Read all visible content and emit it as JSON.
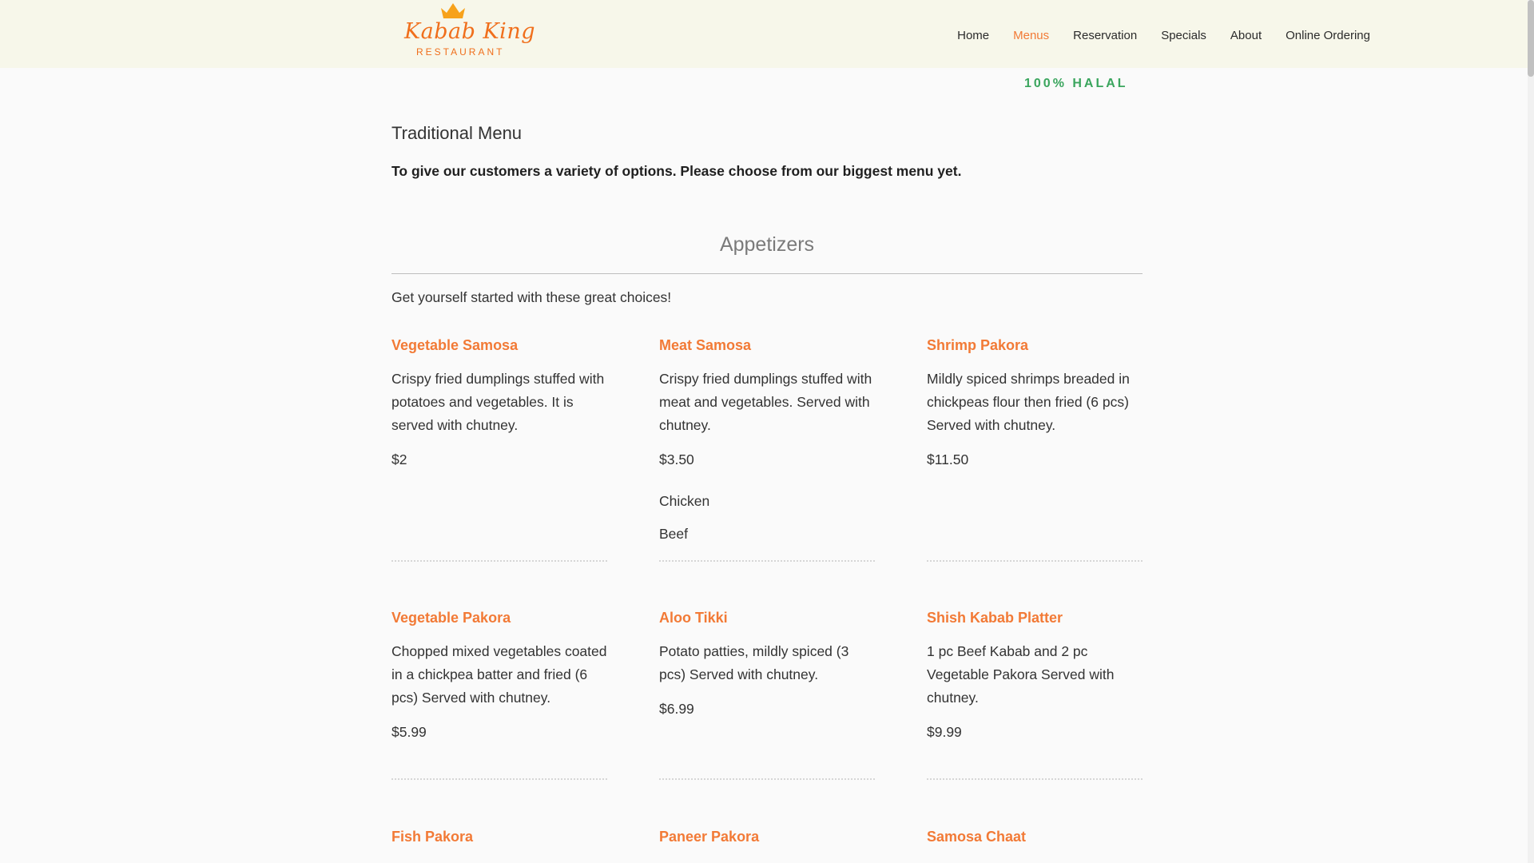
{
  "brand": {
    "name": "Kabab King",
    "subtitle": "RESTAURANT",
    "crown_icon": "crown-icon",
    "color": "#f06f1c"
  },
  "nav": {
    "items": [
      {
        "label": "Home",
        "active": false
      },
      {
        "label": "Menus",
        "active": true
      },
      {
        "label": "Reservation",
        "active": false
      },
      {
        "label": "Specials",
        "active": false
      },
      {
        "label": "About",
        "active": false
      },
      {
        "label": "Online Ordering",
        "active": false
      }
    ],
    "active_color": "#f27a36"
  },
  "halal_badge": "100% HALAL",
  "page": {
    "title": "Traditional Menu",
    "intro": "To give our customers a variety of options. Please choose from our biggest menu yet."
  },
  "section": {
    "title": "Appetizers",
    "description": "Get yourself started with these great choices!"
  },
  "items": [
    {
      "name": "Vegetable Samosa",
      "description": "Crispy fried dumplings stuffed with potatoes and vegetables. It is served with chutney.",
      "price": "$2"
    },
    {
      "name": "Meat Samosa",
      "description": "Crispy fried dumplings stuffed with meat and vegetables. Served with chutney.",
      "price": "$3.50",
      "options": [
        "Chicken",
        "Beef"
      ]
    },
    {
      "name": "Shrimp Pakora",
      "description": "Mildly spiced shrimps breaded in chickpeas flour then fried (6 pcs) Served with chutney.",
      "price": "$11.50"
    },
    {
      "name": "Vegetable Pakora",
      "description": "Chopped mixed vegetables coated in a chickpea batter and fried (6 pcs) Served with chutney.",
      "price": "$5.99"
    },
    {
      "name": "Aloo Tikki",
      "description": "Potato patties, mildly spiced (3 pcs) Served with chutney.",
      "price": "$6.99"
    },
    {
      "name": "Shish Kabab Platter",
      "description": "1 pc Beef Kabab and 2 pc Vegetable Pakora Served with chutney.",
      "price": "$9.99"
    },
    {
      "name": "Fish Pakora"
    },
    {
      "name": "Paneer Pakora"
    },
    {
      "name": "Samosa Chaat"
    }
  ],
  "colors": {
    "header_bg": "#f7f7ea",
    "item_name": "#f27a36",
    "halal": "#3aa55d"
  }
}
